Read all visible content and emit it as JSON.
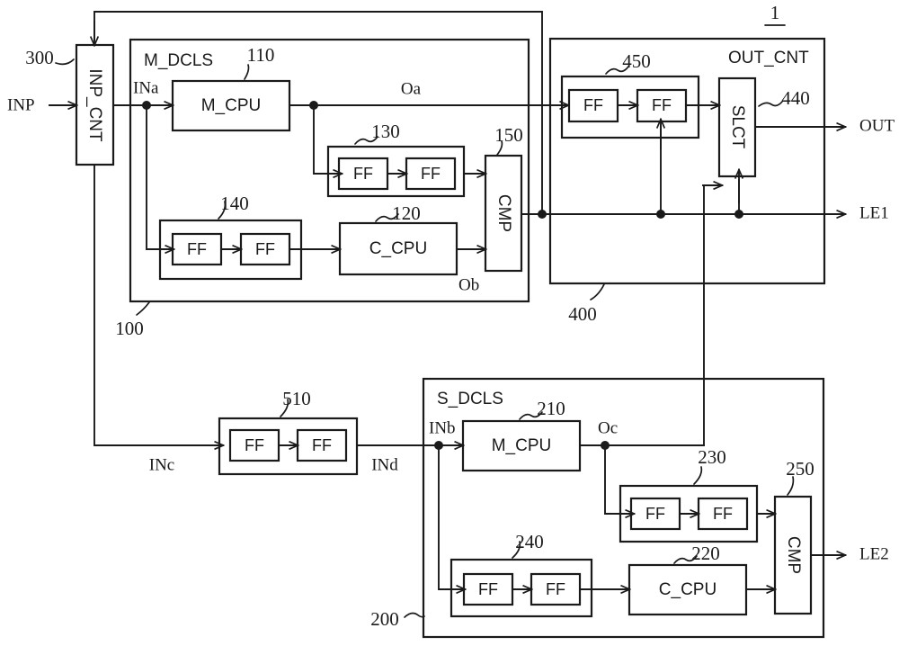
{
  "figure": {
    "number": "1",
    "type": "patent-block-diagram",
    "stroke_color": "#1a1a1a",
    "background_color": "#ffffff"
  },
  "signals": {
    "inp": "INP",
    "ina": "INa",
    "oa": "Oa",
    "ob": "Ob",
    "inb": "INb",
    "inc": "INc",
    "ind": "INd",
    "oc": "Oc",
    "out": "OUT",
    "le1": "LE1",
    "le2": "LE2"
  },
  "blocks": {
    "inp_cnt": {
      "label": "INP_CNT",
      "ref": "300"
    },
    "m_dcls": {
      "module_label": "M_DCLS",
      "ref": "100",
      "m_cpu": {
        "label": "M_CPU",
        "ref": "110"
      },
      "c_cpu": {
        "label": "C_CPU",
        "ref": "120"
      },
      "ff_group_top": {
        "ref": "130",
        "ff1": "FF",
        "ff2": "FF"
      },
      "ff_group_bottom": {
        "ref": "140",
        "ff1": "FF",
        "ff2": "FF"
      },
      "cmp": {
        "label": "CMP",
        "ref": "150"
      }
    },
    "out_cnt": {
      "module_label": "OUT_CNT",
      "ref": "400",
      "slct": {
        "label": "SLCT",
        "ref": "440"
      },
      "ff_group": {
        "ref": "450",
        "ff1": "FF",
        "ff2": "FF"
      }
    },
    "ff_group_510": {
      "ref": "510",
      "ff1": "FF",
      "ff2": "FF"
    },
    "s_dcls": {
      "module_label": "S_DCLS",
      "ref": "200",
      "m_cpu": {
        "label": "M_CPU",
        "ref": "210"
      },
      "c_cpu": {
        "label": "C_CPU",
        "ref": "220"
      },
      "ff_group_top": {
        "ref": "230",
        "ff1": "FF",
        "ff2": "FF"
      },
      "ff_group_bottom": {
        "ref": "240",
        "ff1": "FF",
        "ff2": "FF"
      },
      "cmp": {
        "label": "CMP",
        "ref": "250"
      }
    }
  }
}
